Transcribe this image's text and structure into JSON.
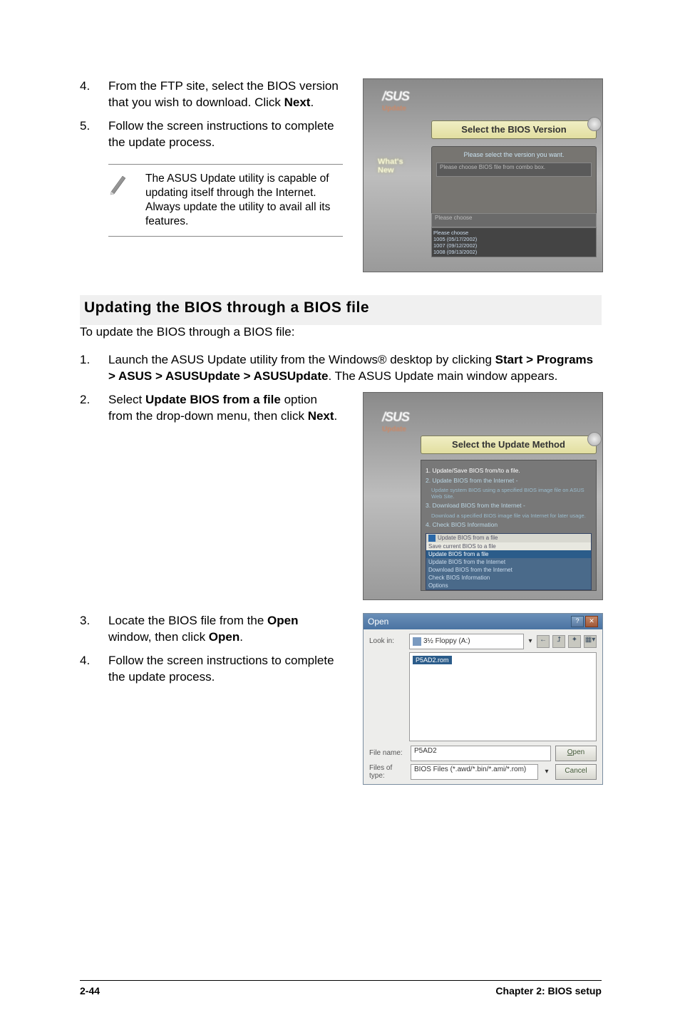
{
  "top_steps": [
    {
      "num": "4.",
      "pre": "From the FTP site, select the BIOS version that you wish to download. Click ",
      "bold": "Next",
      "post": "."
    },
    {
      "num": "5.",
      "pre": "Follow the screen instructions to complete the update process.",
      "bold": "",
      "post": ""
    }
  ],
  "note": "The ASUS Update utility is capable of updating itself through the Internet. Always update the utility to avail all its features.",
  "screenshot1": {
    "logo": "/SUS",
    "banner": "Select the BIOS Version",
    "hint": "Please select the version you want.",
    "combo": "Please choose BIOS file from combo box.",
    "whats": "What's\nNew",
    "dd_label": "Please choose",
    "dd_items": "Please choose\n1005 (05/17/2002)\n1007 (09/12/2002)\n1008 (09/13/2002)"
  },
  "section_heading": "Updating the BIOS through a BIOS file",
  "intro": "To update the BIOS through a BIOS file:",
  "mid_steps": [
    {
      "num": "1.",
      "pre": "Launch the ASUS Update utility from the Windows® desktop by clicking ",
      "bold": "Start > Programs > ASUS > ASUSUpdate > ASUSUpdate",
      "post": ". The ASUS Update main window appears."
    },
    {
      "num": "2.",
      "pre": "Select ",
      "bold": "Update BIOS from a file",
      "post": " option from the drop-down menu, then click ",
      "bold2": "Next",
      "post2": "."
    }
  ],
  "screenshot2": {
    "logo": "/SUS",
    "banner": "Select the Update Method",
    "opts": [
      "1. Update/Save BIOS from/to a file.",
      "2. Update BIOS from the Internet -",
      "Update system BIOS using a specified BIOS image file on ASUS Web Site.",
      "3. Download BIOS from the Internet -",
      "Download a specified BIOS image file via Internet for later usage.",
      "4. Check BIOS Information"
    ],
    "dd_sel": "Update BIOS from a file",
    "dd_items": [
      "Save current BIOS to a file",
      "Update BIOS from a file",
      "Update BIOS from the Internet",
      "Download BIOS from the Internet",
      "Check BIOS Information",
      "Options"
    ]
  },
  "bottom_steps": [
    {
      "num": "3.",
      "pre": "Locate the BIOS file from the ",
      "bold": "Open",
      "post": " window, then click ",
      "bold2": "Open",
      "post2": "."
    },
    {
      "num": "4.",
      "pre": "Follow the screen instructions to complete the update process.",
      "bold": "",
      "post": ""
    }
  ],
  "open_dialog": {
    "title": "Open",
    "lookin_label": "Look in:",
    "lookin_value": "3½ Floppy (A:)",
    "file_item": "P5AD2.rom",
    "filename_label": "File name:",
    "filename_value": "P5AD2",
    "filetype_label": "Files of type:",
    "filetype_value": "BIOS Files (*.awd/*.bin/*.ami/*.rom)",
    "open_btn": "Open",
    "cancel_btn": "Cancel"
  },
  "footer": {
    "left": "2-44",
    "right": "Chapter 2: BIOS setup"
  }
}
